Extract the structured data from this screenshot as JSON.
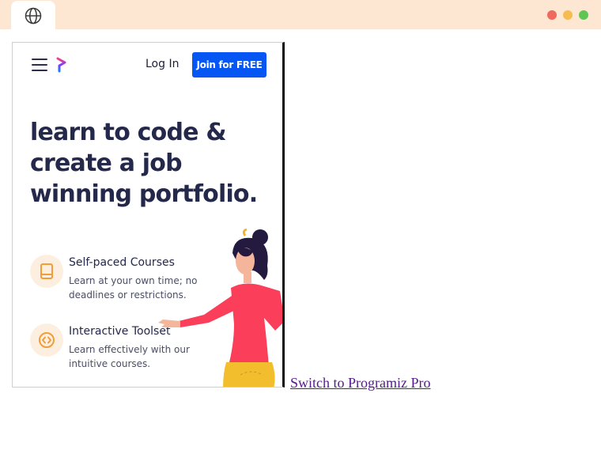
{
  "browser": {
    "tab_icon": "globe-icon",
    "window_controls": {
      "close_color": "#ee6a5f",
      "minimize_color": "#f5bd4f",
      "maximize_color": "#61c554"
    },
    "chrome_color": "#fde7d3"
  },
  "ad": {
    "header": {
      "menu_icon": "hamburger-menu-icon",
      "logo_icon": "programiz-logo-icon",
      "login_label": "Log In",
      "join_label": "Join for FREE",
      "join_color": "#0556f3"
    },
    "headline_lines": [
      "learn to code &",
      "create a job",
      "winning portfolio."
    ],
    "features": [
      {
        "icon": "book-icon",
        "title": "Self-paced Courses",
        "description": "Learn at your own time; no deadlines or restrictions."
      },
      {
        "icon": "code-icon",
        "title": "Interactive Toolset",
        "description": "Learn effectively with our intuitive courses."
      }
    ],
    "illustration": "woman-pointing-illustration"
  },
  "link": {
    "label": "Switch to Programiz Pro"
  }
}
